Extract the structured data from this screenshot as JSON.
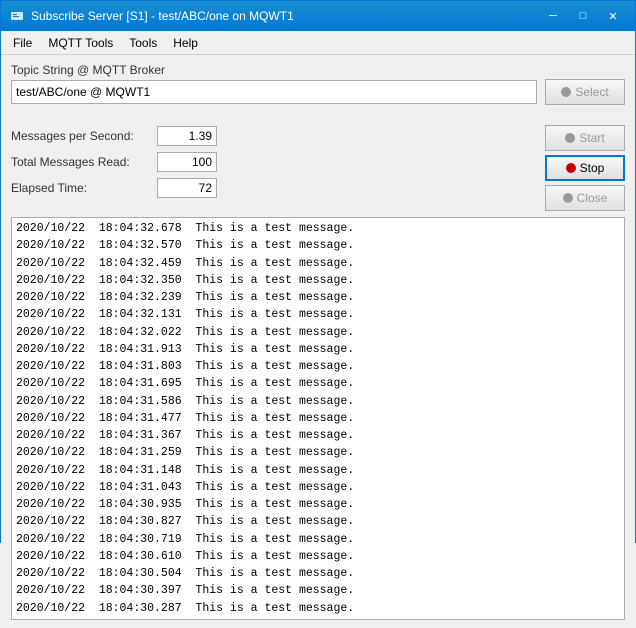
{
  "window": {
    "title": "Subscribe Server [S1] - test/ABC/one on MQWT1"
  },
  "titlebar": {
    "icon": "⬛",
    "minimize": "─",
    "maximize": "□",
    "close": "✕"
  },
  "menu": {
    "items": [
      "File",
      "MQTT Tools",
      "Tools",
      "Help"
    ]
  },
  "topic": {
    "label": "Topic String @ MQTT Broker",
    "value": "test/ABC/one @ MQWT1",
    "placeholder": ""
  },
  "buttons": {
    "select": "Select",
    "start": "Start",
    "stop": "Stop",
    "close": "Close"
  },
  "stats": {
    "messages_per_second_label": "Messages per Second:",
    "messages_per_second_value": "1.39",
    "total_messages_label": "Total Messages Read:",
    "total_messages_value": "100",
    "elapsed_time_label": "Elapsed Time:",
    "elapsed_time_value": "72"
  },
  "log": {
    "lines": [
      "2020/10/22  18:04:32.678  This is a test message.",
      "2020/10/22  18:04:32.570  This is a test message.",
      "2020/10/22  18:04:32.459  This is a test message.",
      "2020/10/22  18:04:32.350  This is a test message.",
      "2020/10/22  18:04:32.239  This is a test message.",
      "2020/10/22  18:04:32.131  This is a test message.",
      "2020/10/22  18:04:32.022  This is a test message.",
      "2020/10/22  18:04:31.913  This is a test message.",
      "2020/10/22  18:04:31.803  This is a test message.",
      "2020/10/22  18:04:31.695  This is a test message.",
      "2020/10/22  18:04:31.586  This is a test message.",
      "2020/10/22  18:04:31.477  This is a test message.",
      "2020/10/22  18:04:31.367  This is a test message.",
      "2020/10/22  18:04:31.259  This is a test message.",
      "2020/10/22  18:04:31.148  This is a test message.",
      "2020/10/22  18:04:31.043  This is a test message.",
      "2020/10/22  18:04:30.935  This is a test message.",
      "2020/10/22  18:04:30.827  This is a test message.",
      "2020/10/22  18:04:30.719  This is a test message.",
      "2020/10/22  18:04:30.610  This is a test message.",
      "2020/10/22  18:04:30.504  This is a test message.",
      "2020/10/22  18:04:30.397  This is a test message.",
      "2020/10/22  18:04:30.287  This is a test message."
    ]
  }
}
